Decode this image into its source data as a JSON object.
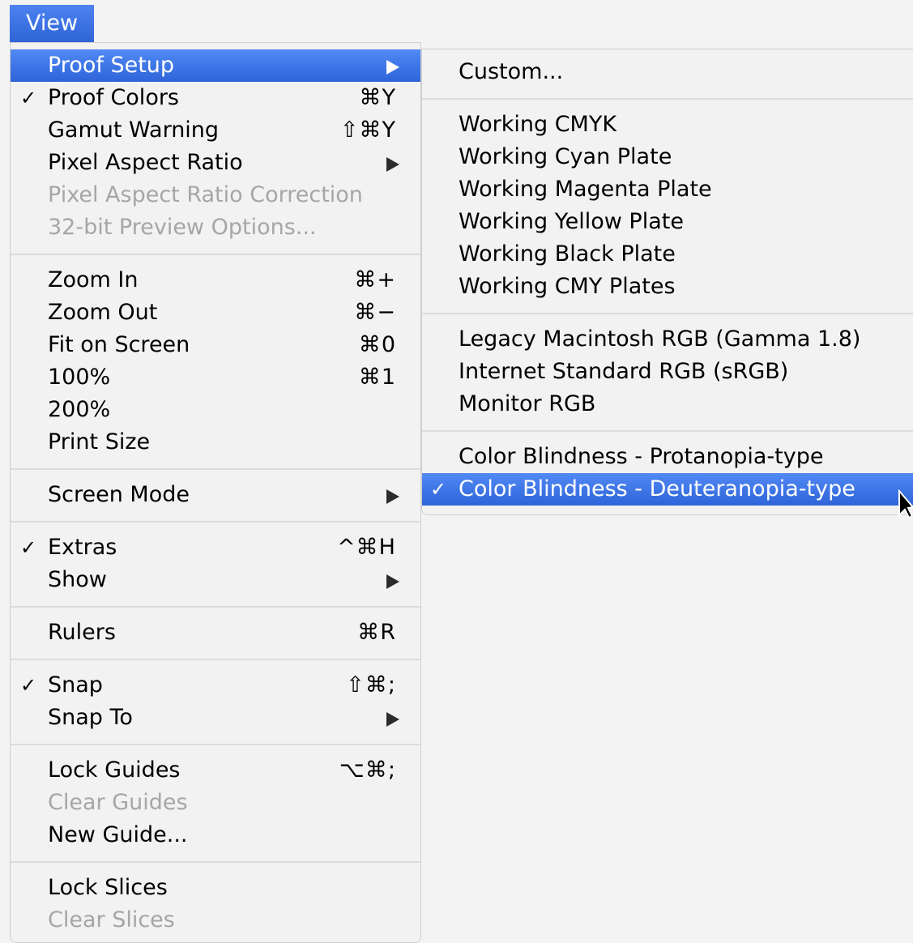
{
  "menubar": {
    "view_label": "View"
  },
  "colors": {
    "selection": "#3a6fe0",
    "disabled_text": "#a6a6a6",
    "menu_bg": "#f2f2f2"
  },
  "main_menu": {
    "proof_setup": "Proof Setup",
    "proof_colors": {
      "label": "Proof Colors",
      "shortcut": "⌘Y",
      "check": "✓"
    },
    "gamut_warning": {
      "label": "Gamut Warning",
      "shortcut": "⇧⌘Y"
    },
    "pixel_aspect_ratio": "Pixel Aspect Ratio",
    "pixel_aspect_ratio_correction": "Pixel Aspect Ratio Correction",
    "preview_options": "32-bit Preview Options...",
    "zoom_in": {
      "label": "Zoom In",
      "shortcut": "⌘+"
    },
    "zoom_out": {
      "label": "Zoom Out",
      "shortcut": "⌘−"
    },
    "fit_on_screen": {
      "label": "Fit on Screen",
      "shortcut": "⌘0"
    },
    "zoom_100": {
      "label": "100%",
      "shortcut": "⌘1"
    },
    "zoom_200": "200%",
    "print_size": "Print Size",
    "screen_mode": "Screen Mode",
    "extras": {
      "label": "Extras",
      "shortcut": "^⌘H",
      "check": "✓"
    },
    "show": "Show",
    "rulers": {
      "label": "Rulers",
      "shortcut": "⌘R"
    },
    "snap": {
      "label": "Snap",
      "shortcut": "⇧⌘;",
      "check": "✓"
    },
    "snap_to": "Snap To",
    "lock_guides": {
      "label": "Lock Guides",
      "shortcut": "⌥⌘;"
    },
    "clear_guides": "Clear Guides",
    "new_guide": "New Guide...",
    "lock_slices": "Lock Slices",
    "clear_slices": "Clear Slices"
  },
  "proof_submenu": {
    "custom": "Custom...",
    "working_cmyk": "Working CMYK",
    "working_cyan": "Working Cyan Plate",
    "working_magenta": "Working Magenta Plate",
    "working_yellow": "Working Yellow Plate",
    "working_black": "Working Black Plate",
    "working_cmy": "Working CMY Plates",
    "legacy_mac_rgb": "Legacy Macintosh RGB (Gamma 1.8)",
    "internet_srgb": "Internet Standard RGB (sRGB)",
    "monitor_rgb": "Monitor RGB",
    "protanopia": "Color Blindness - Protanopia-type",
    "deuteranopia": {
      "label": "Color Blindness - Deuteranopia-type",
      "check": "✓"
    }
  }
}
